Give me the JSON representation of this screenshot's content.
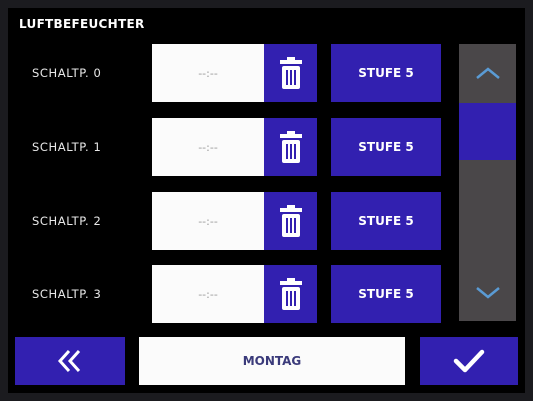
{
  "header": {
    "title": "LUFTBEFEUCHTER"
  },
  "rows": [
    {
      "label": "SCHALTP. 0",
      "time": "--:--",
      "level": "STUFE 5"
    },
    {
      "label": "SCHALTP. 1",
      "time": "--:--",
      "level": "STUFE 5"
    },
    {
      "label": "SCHALTP. 2",
      "time": "--:--",
      "level": "STUFE 5"
    },
    {
      "label": "SCHALTP. 3",
      "time": "--:--",
      "level": "STUFE 5"
    }
  ],
  "footer": {
    "day": "MONTAG"
  },
  "icons": {
    "delete": "trash-icon",
    "scroll_up": "chevron-up-icon",
    "scroll_down": "chevron-down-icon",
    "back": "double-chevron-left-icon",
    "confirm": "checkmark-icon"
  },
  "colors": {
    "accent": "#3220b0",
    "field": "#fbfbfb",
    "track": "#4a4749",
    "background": "#000000"
  }
}
